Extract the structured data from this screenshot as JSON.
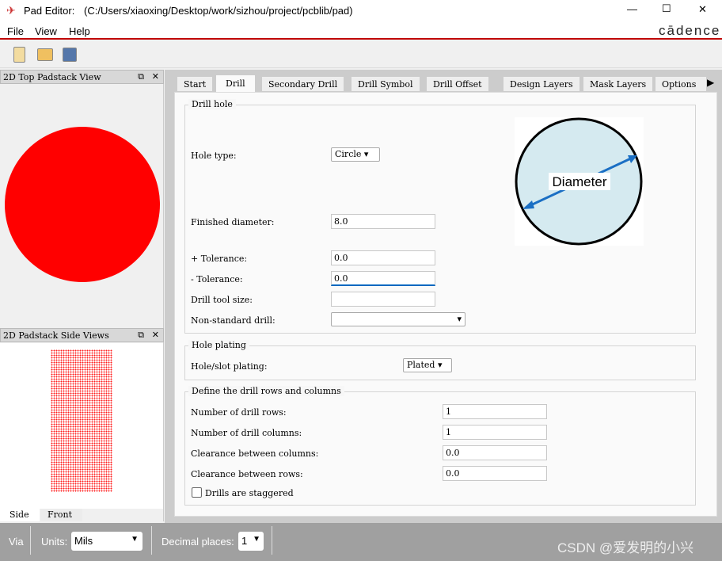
{
  "window": {
    "app": "Pad Editor:",
    "path": "(C:/Users/xiaoxing/Desktop/work/sizhou/project/pcblib/pad)",
    "min": "—",
    "max": "☐",
    "close": "✕"
  },
  "menu": [
    "File",
    "View",
    "Help"
  ],
  "brand": "cādence",
  "toolbar": {
    "icons": [
      "new-file-icon",
      "open-folder-icon",
      "save-icon"
    ]
  },
  "top_view": {
    "title": "2D Top Padstack View",
    "pad_color": "#ff0000"
  },
  "side_view": {
    "title": "2D Padstack Side Views",
    "tabs": [
      "Side",
      "Front"
    ],
    "active": "Side"
  },
  "tabs": [
    "Start",
    "Drill",
    "Secondary Drill",
    "Drill Symbol",
    "Drill Offset",
    "Design Layers",
    "Mask Layers",
    "Options"
  ],
  "active_tab": "Drill",
  "drill_hole": {
    "title": "Drill hole",
    "hole_type_label": "Hole type:",
    "hole_type": "Circle",
    "finished_label": "Finished diameter:",
    "finished": "8.0",
    "plus_tol_label": "+ Tolerance:",
    "plus_tol": "0.0",
    "minus_tol_label": "- Tolerance:",
    "minus_tol": "0.0",
    "tool_label": "Drill tool size:",
    "tool": "",
    "nonstd_label": "Non-standard drill:",
    "nonstd": "",
    "diagram_label": "Diameter"
  },
  "plating": {
    "title": "Hole plating",
    "label": "Hole/slot plating:",
    "value": "Plated"
  },
  "rows_cols": {
    "title": "Define the drill rows and columns",
    "rows_label": "Number of drill rows:",
    "rows": "1",
    "cols_label": "Number of drill columns:",
    "cols": "1",
    "clr_cols_label": "Clearance between columns:",
    "clr_cols": "0.0",
    "clr_rows_label": "Clearance between rows:",
    "clr_rows": "0.0",
    "staggered_label": "Drills are staggered",
    "staggered": false
  },
  "status": {
    "type": "Via",
    "units_label": "Units:",
    "units": "Mils",
    "decimal_label": "Decimal places:",
    "decimal": "1",
    "watermark": "CSDN @爱发明的小兴"
  }
}
